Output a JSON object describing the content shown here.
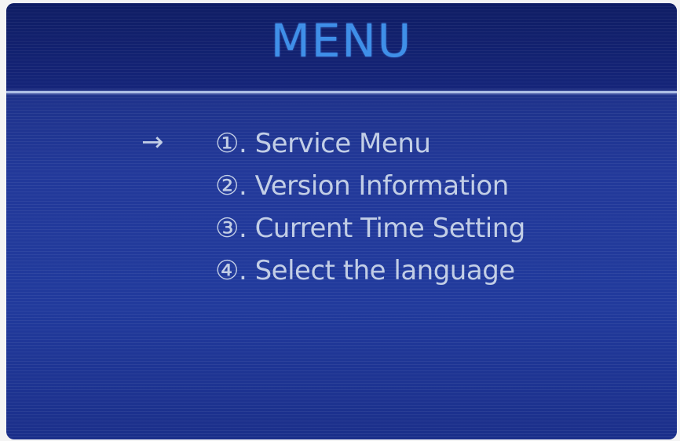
{
  "screen": {
    "title": "MENU",
    "cursor_glyph": "→",
    "selected_index": 0,
    "colors": {
      "title": "#3f8fe8",
      "text": "#c2cee6",
      "background": "#22399a",
      "header": "#15257a",
      "divider": "#aebfe6"
    }
  },
  "menu": {
    "items": [
      {
        "label": "①. Service Menu"
      },
      {
        "label": "②. Version Information"
      },
      {
        "label": "③. Current Time Setting"
      },
      {
        "label": "④. Select the language"
      }
    ]
  }
}
